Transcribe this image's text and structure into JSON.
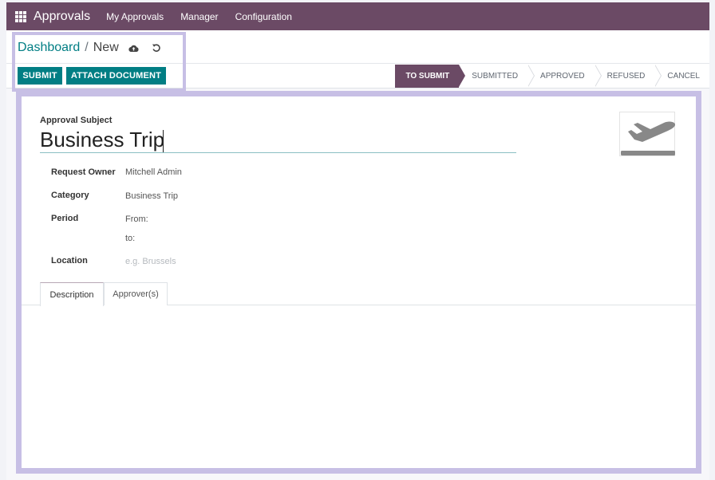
{
  "navbar": {
    "brand": "Approvals",
    "items": [
      "My Approvals",
      "Manager",
      "Configuration"
    ],
    "color": "#6b4a65"
  },
  "breadcrumb": {
    "parent": "Dashboard",
    "separator": "/",
    "current": "New",
    "save_icon": "cloud-upload-icon",
    "discard_icon": "undo-icon"
  },
  "actions": {
    "submit_label": "SUBMIT",
    "attach_label": "ATTACH DOCUMENT",
    "accent": "#017e84"
  },
  "statusbar": {
    "stages": [
      "TO SUBMIT",
      "SUBMITTED",
      "APPROVED",
      "REFUSED",
      "CANCEL"
    ],
    "active": "TO SUBMIT"
  },
  "form": {
    "subject_label": "Approval Subject",
    "subject_value": "Business Trip",
    "image_icon": "airplane-departure-icon",
    "fields": {
      "owner_label": "Request Owner",
      "owner_value": "Mitchell Admin",
      "category_label": "Category",
      "category_value": "Business Trip",
      "period_label": "Period",
      "period_from": "From:",
      "period_to": "to:",
      "location_label": "Location",
      "location_placeholder": "e.g. Brussels"
    },
    "tabs": [
      "Description",
      "Approver(s)"
    ],
    "active_tab": "Description"
  },
  "highlight_color": "#c7bfe5"
}
